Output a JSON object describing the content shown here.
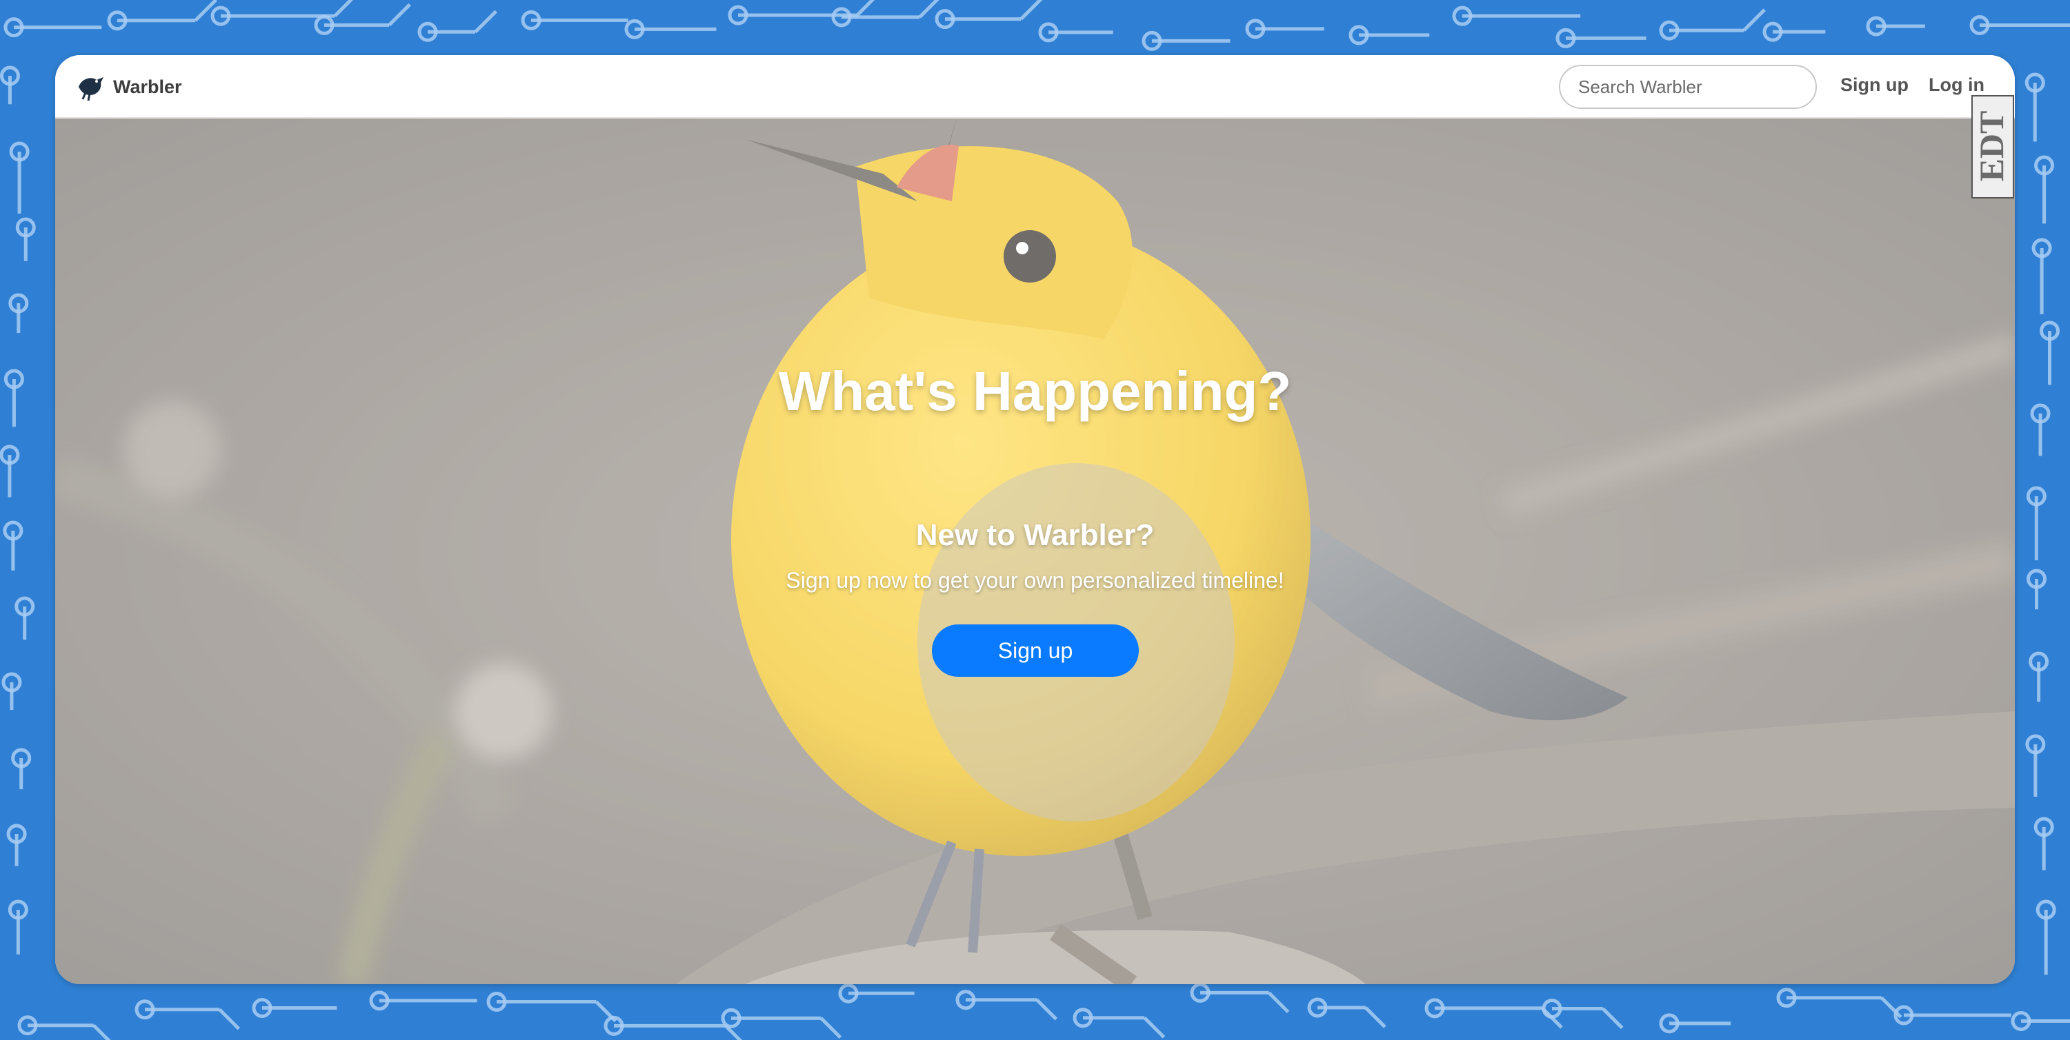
{
  "navbar": {
    "brand_name": "Warbler",
    "search_placeholder": "Search Warbler",
    "signup_label": "Sign up",
    "login_label": "Log in"
  },
  "badge": {
    "text": "EDT"
  },
  "hero": {
    "title": "What's Happening?",
    "subtitle": "New to Warbler?",
    "tagline": "Sign up now to get your own personalized timeline!",
    "button_label": "Sign up"
  },
  "icons": {
    "logo": "bird-logo-icon",
    "search": "search-icon"
  },
  "colors": {
    "page_background": "#2f80d4",
    "circuit_lines": "#a9cdf2",
    "primary_button": "#0a7aff",
    "bird_yellow": "#f1c21b"
  }
}
